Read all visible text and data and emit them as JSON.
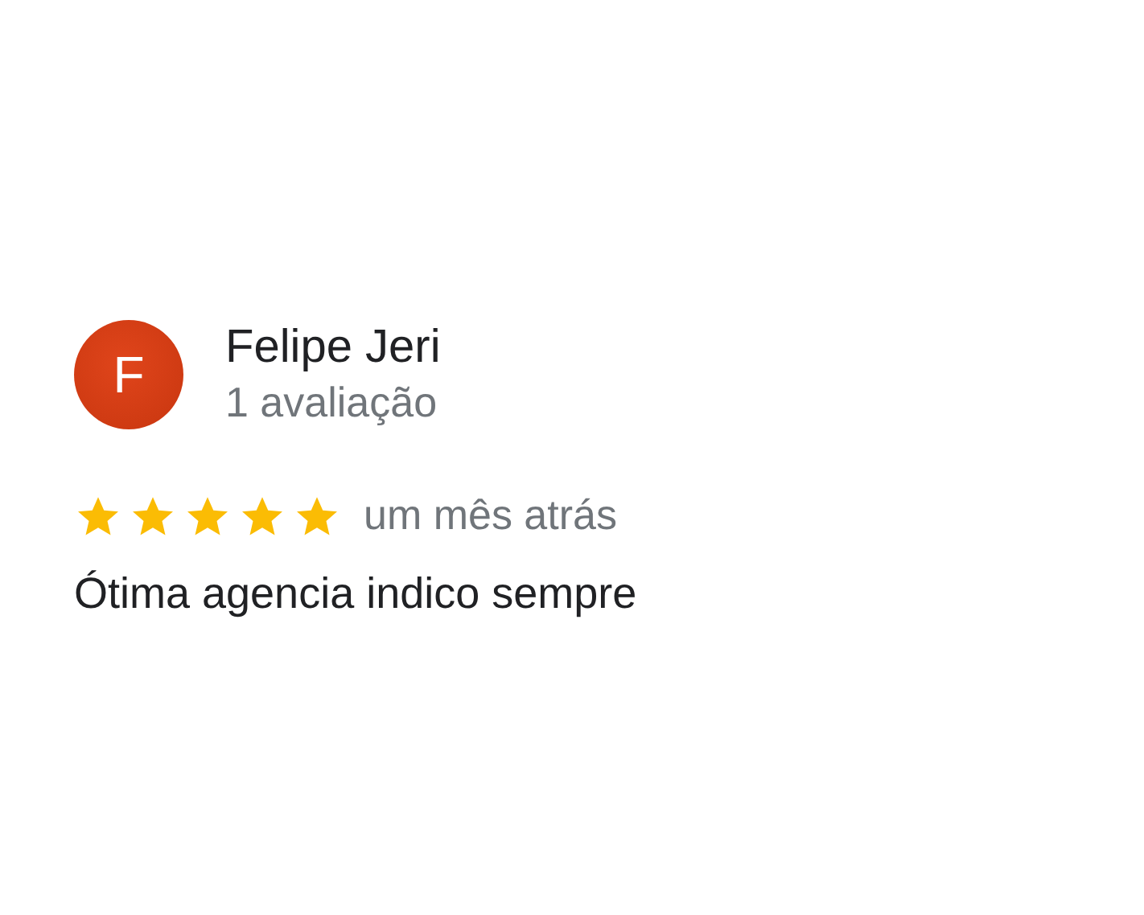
{
  "reviewer": {
    "initial": "F",
    "name": "Felipe Jeri",
    "review_count": "1 avaliação"
  },
  "review": {
    "stars": 5,
    "time": "um mês atrás",
    "text": "Ótima agencia indico sempre"
  }
}
